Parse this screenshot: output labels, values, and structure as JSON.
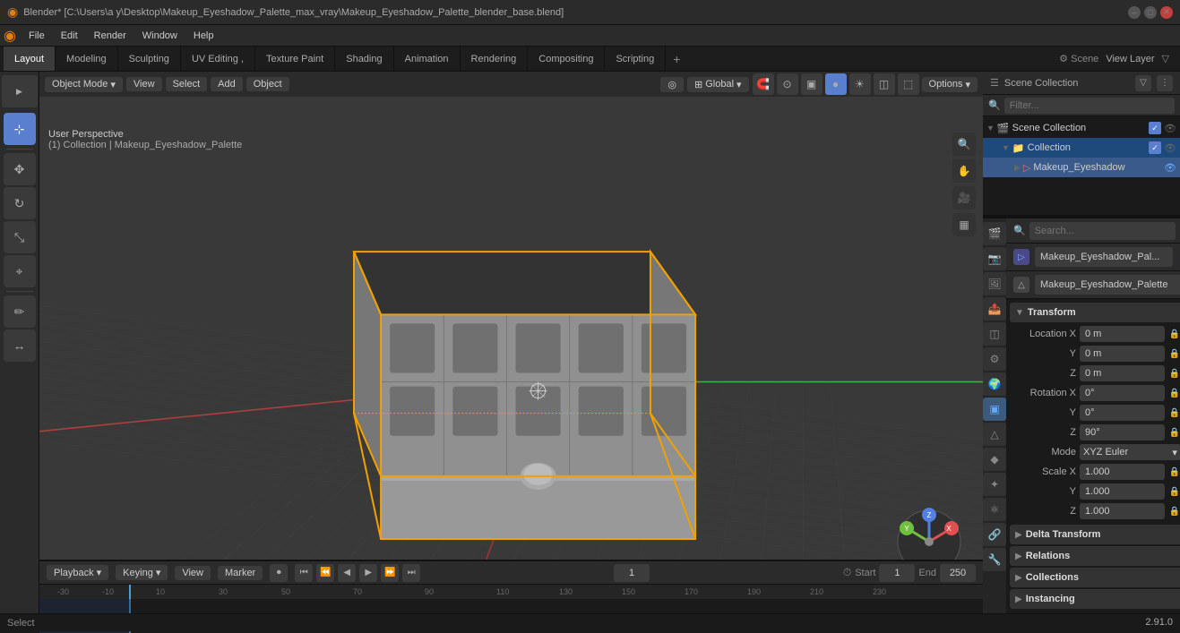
{
  "titlebar": {
    "title": "Blender* [C:\\Users\\a y\\Desktop\\Makeup_Eyeshadow_Palette_max_vray\\Makeup_Eyeshadow_Palette_blender_base.blend]",
    "controls": [
      "–",
      "□",
      "✕"
    ]
  },
  "menubar": {
    "items": [
      "Blender",
      "File",
      "Edit",
      "Render",
      "Window",
      "Help"
    ]
  },
  "workspace_tabs": {
    "tabs": [
      "Layout",
      "Modeling",
      "Sculpting",
      "UV Editing",
      ",",
      "Texture Paint",
      "Shading",
      "Animation",
      "Rendering",
      "Compositing",
      "Scripting"
    ],
    "active": "Layout",
    "plus": "+",
    "right": {
      "scene_label": "Scene",
      "view_layer_label": "View Layer"
    }
  },
  "viewport": {
    "mode": "Object Mode",
    "view_menu": "View",
    "select_menu": "Select",
    "add_menu": "Add",
    "object_menu": "Object",
    "transform": "Global",
    "options_label": "Options",
    "info_perspective": "User Perspective",
    "info_collection": "(1) Collection | Makeup_Eyeshadow_Palette"
  },
  "gizmo": {
    "x_color": "#e05050",
    "y_color": "#70c040",
    "z_color": "#5080e0",
    "x_label": "X",
    "y_label": "Y",
    "z_label": "Z"
  },
  "timeline": {
    "playback_label": "Playback",
    "keying_label": "Keying",
    "view_label": "View",
    "marker_label": "Marker",
    "current_frame": "1",
    "start_frame": "1",
    "end_frame": "250",
    "start_label": "Start",
    "end_label": "End"
  },
  "outliner": {
    "title": "Scene Collection",
    "items": [
      {
        "label": "Collection",
        "icon": "📁",
        "indent": 0,
        "checked": true,
        "visible": true,
        "expanded": true
      },
      {
        "label": "Makeup_Eyeshadow",
        "icon": "▷",
        "indent": 2,
        "checked": false,
        "visible": true,
        "expanded": false,
        "selected": true
      }
    ]
  },
  "properties": {
    "object_name": "Makeup_Eyeshadow_Pal...",
    "data_name": "Makeup_Eyeshadow_Palette",
    "transform": {
      "title": "Transform",
      "location": {
        "x": "0 m",
        "y": "0 m",
        "z": "0 m"
      },
      "rotation": {
        "x": "0°",
        "y": "0°",
        "z": "90°"
      },
      "mode": "XYZ Euler",
      "scale": {
        "x": "1.000",
        "y": "1.000",
        "z": "1.000"
      }
    },
    "delta_transform": {
      "title": "Delta Transform",
      "collapsed": true
    },
    "relations": {
      "title": "Relations",
      "collapsed": true
    },
    "collections": {
      "title": "Collections",
      "collapsed": true
    },
    "instancing": {
      "title": "Instancing",
      "collapsed": true
    }
  },
  "statusbar": {
    "select": "Select",
    "version": "2.91.0"
  },
  "icons": {
    "cursor": "⊕",
    "move": "✥",
    "rotate": "↻",
    "scale": "⤢",
    "transform": "⟲",
    "annotate": "✏",
    "measure": "📐",
    "search": "🔍",
    "camera": "🎥",
    "grid": "▦",
    "eye": "👁",
    "lock": "🔒",
    "dot": "●",
    "check": "✓",
    "arrow_right": "▶",
    "arrow_down": "▼",
    "arrow_left": "◀",
    "pin": "📌"
  }
}
